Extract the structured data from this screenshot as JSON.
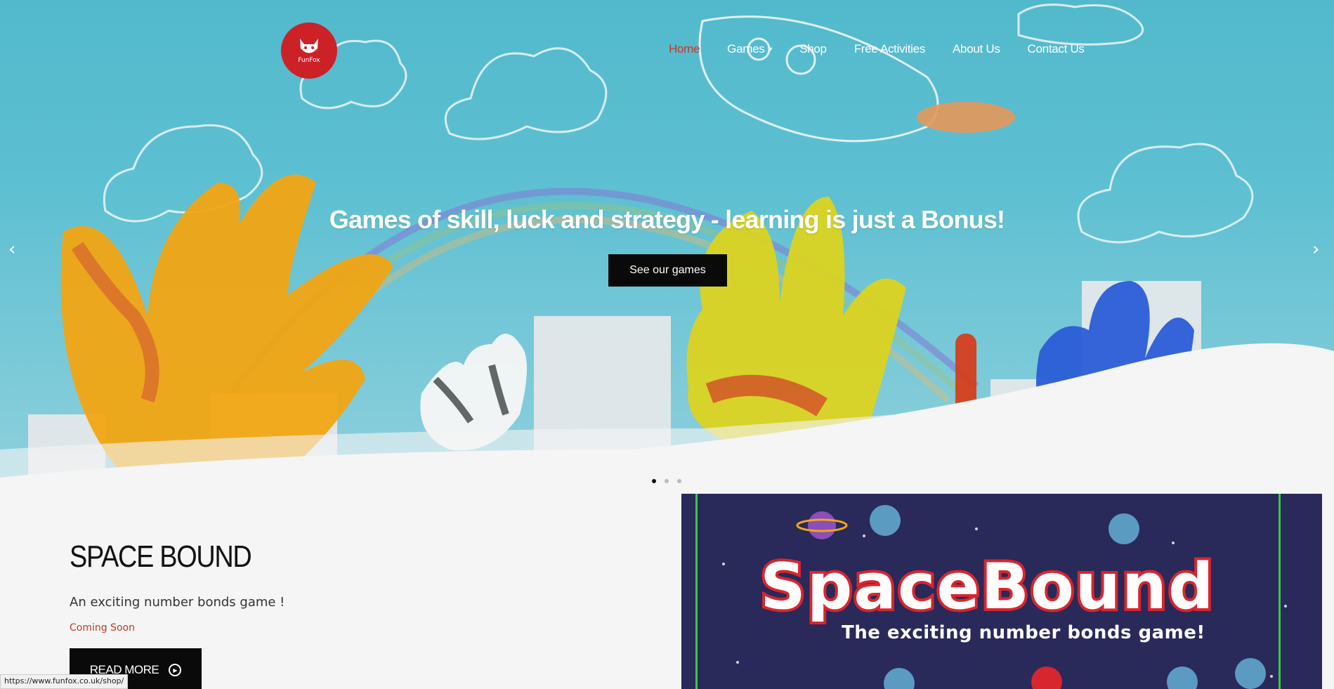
{
  "header": {
    "logo_text": "FunFox",
    "nav": [
      {
        "label": "Home",
        "active": true
      },
      {
        "label": "Games",
        "has_dropdown": true
      },
      {
        "label": "Shop"
      },
      {
        "label": "Free Activities"
      },
      {
        "label": "About Us"
      },
      {
        "label": "Contact Us"
      }
    ]
  },
  "hero": {
    "headline": "Games of skill, luck and strategy - learning is just a Bonus!",
    "cta_label": "See our games",
    "prev_icon": "chevron-left-icon",
    "next_icon": "chevron-right-icon",
    "slides": 3,
    "active_slide": 1
  },
  "feature": {
    "title": "SPACE BOUND",
    "description": "An exciting number bonds game !",
    "status": "Coming Soon",
    "button_label": "READ MORE",
    "image": {
      "logo_text": "SpaceBound",
      "tagline": "The exciting number bonds game!"
    }
  },
  "status_bar": {
    "url": "https://www.funfox.co.uk/shop/"
  },
  "colors": {
    "brand_red": "#cc2127",
    "nav_active": "#c7372b",
    "sky": "#52b9cc",
    "button_dark": "#0a0a0a",
    "coming_soon": "#c0392b"
  }
}
